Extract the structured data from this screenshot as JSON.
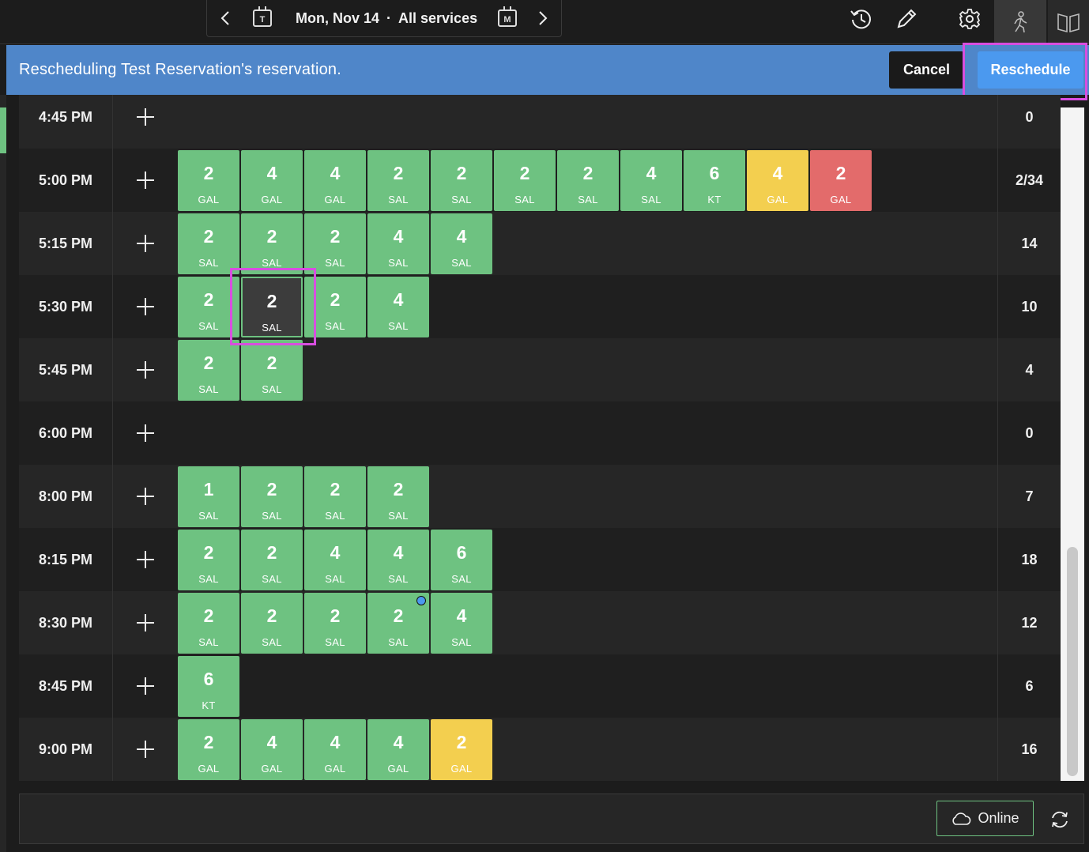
{
  "header": {
    "date": "Mon, Nov 14",
    "separator": "·",
    "service": "All services",
    "today_tile": "T",
    "month_tile": "M"
  },
  "banner": {
    "message": "Rescheduling Test Reservation's reservation.",
    "cancel_label": "Cancel",
    "reschedule_label": "Reschedule"
  },
  "colors": {
    "green": "#6ec281",
    "yellow": "#f3cf4f",
    "red": "#e36b6b",
    "banner": "#4f86c9",
    "accent": "#4b99ef",
    "highlight": "#d84ee0"
  },
  "rows": [
    {
      "time": "4:45 PM",
      "count": "0",
      "tiles": []
    },
    {
      "time": "5:00 PM",
      "count": "2/34",
      "tiles": [
        {
          "n": "2",
          "s": "GAL",
          "c": "green"
        },
        {
          "n": "4",
          "s": "GAL",
          "c": "green"
        },
        {
          "n": "4",
          "s": "GAL",
          "c": "green"
        },
        {
          "n": "2",
          "s": "SAL",
          "c": "green"
        },
        {
          "n": "2",
          "s": "SAL",
          "c": "green"
        },
        {
          "n": "2",
          "s": "SAL",
          "c": "green"
        },
        {
          "n": "2",
          "s": "SAL",
          "c": "green"
        },
        {
          "n": "4",
          "s": "SAL",
          "c": "green"
        },
        {
          "n": "6",
          "s": "KT",
          "c": "green"
        },
        {
          "n": "4",
          "s": "GAL",
          "c": "yellow"
        },
        {
          "n": "2",
          "s": "GAL",
          "c": "red"
        }
      ]
    },
    {
      "time": "5:15 PM",
      "count": "14",
      "tiles": [
        {
          "n": "2",
          "s": "SAL",
          "c": "green"
        },
        {
          "n": "2",
          "s": "SAL",
          "c": "green"
        },
        {
          "n": "2",
          "s": "SAL",
          "c": "green"
        },
        {
          "n": "4",
          "s": "SAL",
          "c": "green"
        },
        {
          "n": "4",
          "s": "SAL",
          "c": "green"
        }
      ]
    },
    {
      "time": "5:30 PM",
      "count": "10",
      "tiles": [
        {
          "n": "2",
          "s": "SAL",
          "c": "green"
        },
        {
          "n": "2",
          "s": "SAL",
          "c": "selected"
        },
        {
          "n": "2",
          "s": "SAL",
          "c": "green"
        },
        {
          "n": "4",
          "s": "SAL",
          "c": "green"
        }
      ]
    },
    {
      "time": "5:45 PM",
      "count": "4",
      "tiles": [
        {
          "n": "2",
          "s": "SAL",
          "c": "green"
        },
        {
          "n": "2",
          "s": "SAL",
          "c": "green"
        }
      ]
    },
    {
      "time": "6:00 PM",
      "count": "0",
      "tiles": []
    },
    {
      "time": "8:00 PM",
      "count": "7",
      "tiles": [
        {
          "n": "1",
          "s": "SAL",
          "c": "green"
        },
        {
          "n": "2",
          "s": "SAL",
          "c": "green"
        },
        {
          "n": "2",
          "s": "SAL",
          "c": "green"
        },
        {
          "n": "2",
          "s": "SAL",
          "c": "green"
        }
      ]
    },
    {
      "time": "8:15 PM",
      "count": "18",
      "tiles": [
        {
          "n": "2",
          "s": "SAL",
          "c": "green"
        },
        {
          "n": "2",
          "s": "SAL",
          "c": "green"
        },
        {
          "n": "4",
          "s": "SAL",
          "c": "green"
        },
        {
          "n": "4",
          "s": "SAL",
          "c": "green"
        },
        {
          "n": "6",
          "s": "SAL",
          "c": "green"
        }
      ]
    },
    {
      "time": "8:30 PM",
      "count": "12",
      "tiles": [
        {
          "n": "2",
          "s": "SAL",
          "c": "green"
        },
        {
          "n": "2",
          "s": "SAL",
          "c": "green"
        },
        {
          "n": "2",
          "s": "SAL",
          "c": "green"
        },
        {
          "n": "2",
          "s": "SAL",
          "c": "green"
        },
        {
          "n": "4",
          "s": "SAL",
          "c": "green"
        }
      ]
    },
    {
      "time": "8:45 PM",
      "count": "6",
      "tiles": [
        {
          "n": "6",
          "s": "KT",
          "c": "green"
        }
      ]
    },
    {
      "time": "9:00 PM",
      "count": "16",
      "tiles": [
        {
          "n": "2",
          "s": "GAL",
          "c": "green"
        },
        {
          "n": "4",
          "s": "GAL",
          "c": "green"
        },
        {
          "n": "4",
          "s": "GAL",
          "c": "green"
        },
        {
          "n": "4",
          "s": "GAL",
          "c": "green"
        },
        {
          "n": "2",
          "s": "GAL",
          "c": "yellow"
        }
      ]
    }
  ],
  "footer": {
    "online_label": "Online"
  },
  "icons": {
    "prev": "chevron-left-icon",
    "next": "chevron-right-icon",
    "history": "history-icon",
    "edit": "pencil-icon",
    "settings": "gear-icon",
    "walkin": "walk-in-icon",
    "book": "book-icon",
    "cloud": "cloud-icon",
    "refresh": "refresh-icon"
  }
}
